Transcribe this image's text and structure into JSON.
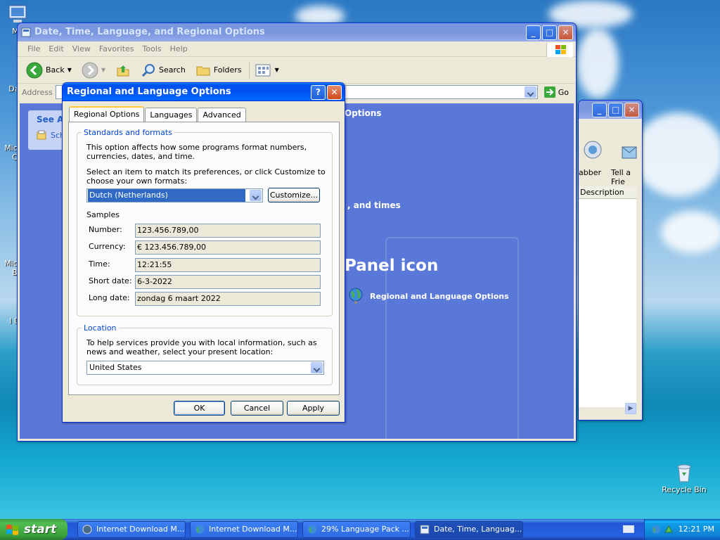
{
  "desktop": {
    "icons": [
      {
        "label": "My",
        "x_hint": "top-left"
      },
      {
        "label": "Dat"
      },
      {
        "label": "Micro C"
      },
      {
        "label": "Micro B"
      },
      {
        "label": "I D"
      }
    ],
    "recycle_bin": "Recycle Bin"
  },
  "control_panel": {
    "title": "Date, Time, Language, and Regional Options",
    "menu": [
      "File",
      "Edit",
      "View",
      "Favorites",
      "Tools",
      "Help"
    ],
    "toolbar": {
      "back": "Back",
      "search": "Search",
      "folders": "Folders"
    },
    "address_label": "Address",
    "go_label": "Go",
    "see_also": "See Als",
    "left_item": "Sch",
    "heading_fragment": "Options",
    "dates_fragment": ", and times",
    "big_heading": "Panel icon",
    "link": "Regional and Language Options"
  },
  "bg_window": {
    "tool_labels": [
      "abber",
      "Tell a Frie"
    ],
    "column": "Description"
  },
  "dialog": {
    "title": "Regional and Language Options",
    "tabs": [
      "Regional Options",
      "Languages",
      "Advanced"
    ],
    "standards": {
      "legend": "Standards and formats",
      "description": "This option affects how some programs format numbers, currencies, dates, and time.",
      "prompt": "Select an item to match its preferences, or click Customize to choose your own formats:",
      "selected": "Dutch (Netherlands)",
      "customize": "Customize...",
      "samples_heading": "Samples",
      "samples": [
        {
          "label": "Number:",
          "value": "123.456.789,00"
        },
        {
          "label": "Currency:",
          "value": "€ 123.456.789,00"
        },
        {
          "label": "Time:",
          "value": "12:21:55"
        },
        {
          "label": "Short date:",
          "value": "6-3-2022"
        },
        {
          "label": "Long date:",
          "value": "zondag 6 maart 2022"
        }
      ]
    },
    "location": {
      "legend": "Location",
      "description": "To help services provide you with local information, such as news and weather, select your present location:",
      "selected": "United States"
    },
    "buttons": {
      "ok": "OK",
      "cancel": "Cancel",
      "apply": "Apply"
    }
  },
  "taskbar": {
    "start": "start",
    "tasks": [
      {
        "label": "Internet Download M..."
      },
      {
        "label": "Internet Download M..."
      },
      {
        "label": "29% Language Pack ..."
      },
      {
        "label": "Date, Time, Languag..."
      }
    ],
    "clock": "12:21 PM"
  }
}
